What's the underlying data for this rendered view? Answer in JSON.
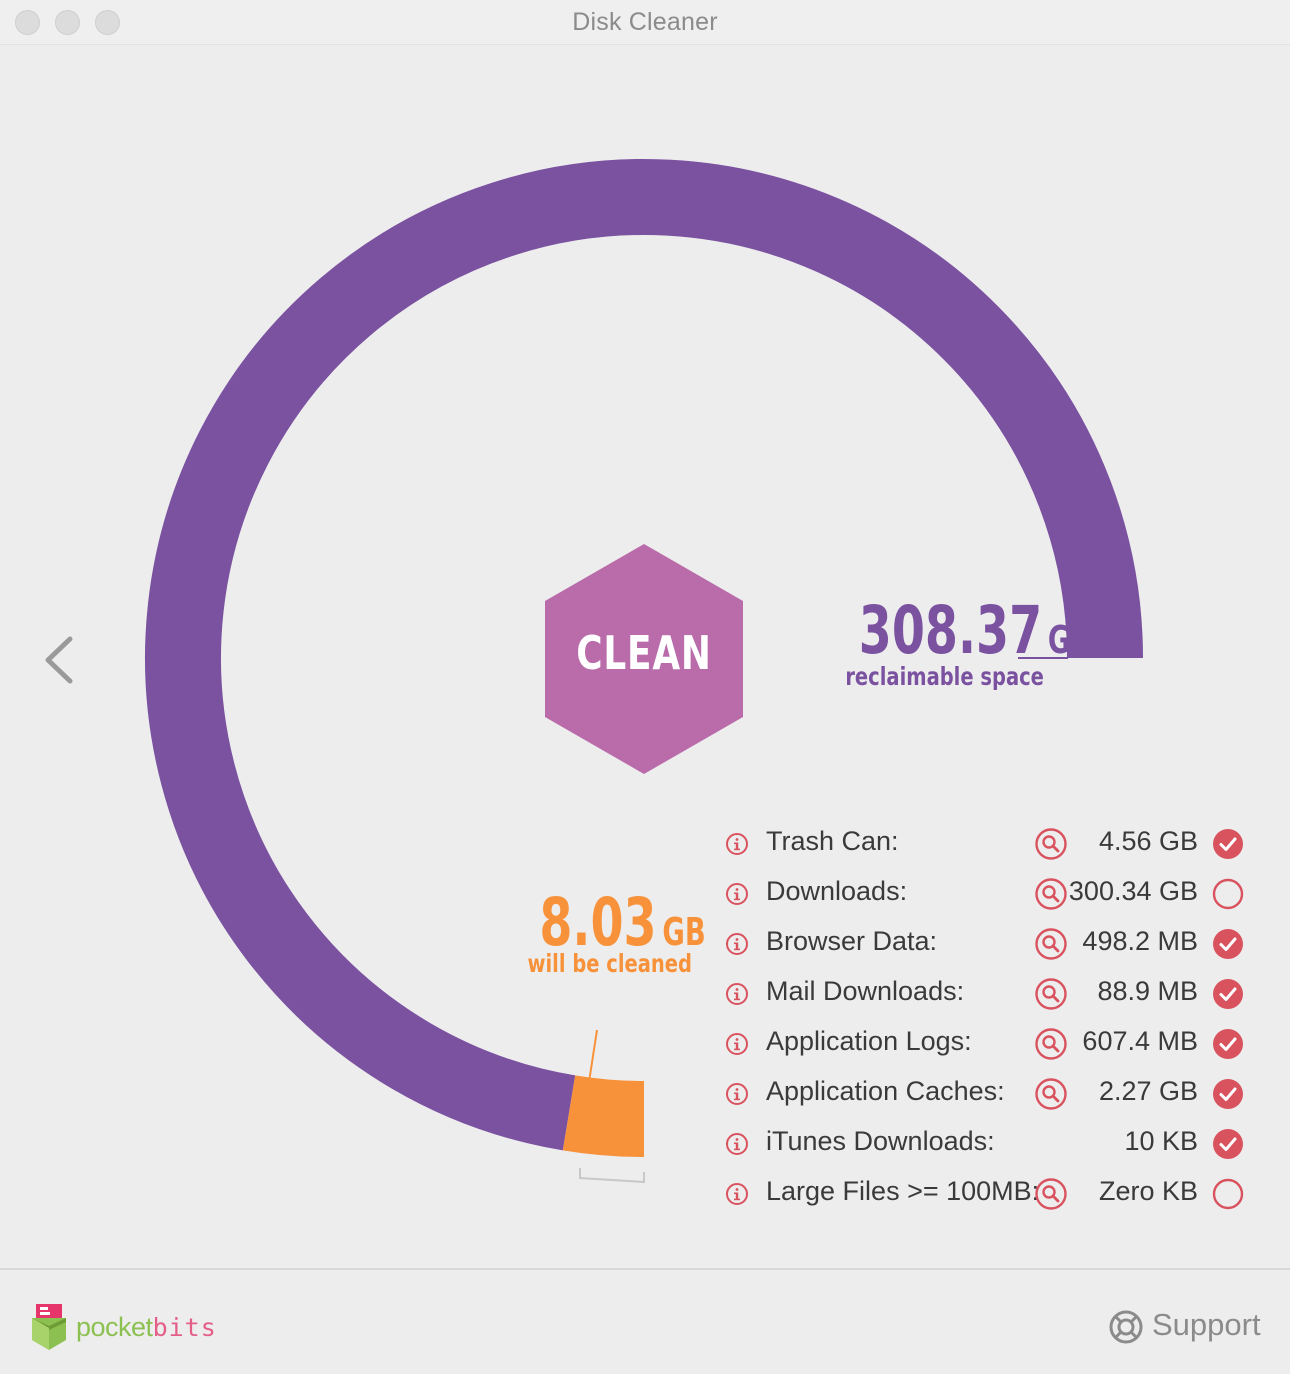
{
  "window": {
    "title": "Disk Cleaner"
  },
  "gauge": {
    "reclaimable_value": "308.37",
    "reclaimable_unit": "GB",
    "reclaimable_label": "reclaimable space",
    "cleaned_value": "8.03",
    "cleaned_unit": "GB",
    "cleaned_label": "will be cleaned",
    "fraction_to_clean": 0.026,
    "button_label": "CLEAN"
  },
  "items": [
    {
      "label": "Trash Can:",
      "size": "4.56 GB",
      "checked": true,
      "has_search": true
    },
    {
      "label": "Downloads:",
      "size": "300.34 GB",
      "checked": false,
      "has_search": true
    },
    {
      "label": "Browser Data:",
      "size": "498.2 MB",
      "checked": true,
      "has_search": true
    },
    {
      "label": "Mail Downloads:",
      "size": "88.9 MB",
      "checked": true,
      "has_search": true
    },
    {
      "label": "Application Logs:",
      "size": "607.4 MB",
      "checked": true,
      "has_search": true
    },
    {
      "label": "Application Caches:",
      "size": "2.27 GB",
      "checked": true,
      "has_search": true
    },
    {
      "label": "iTunes Downloads:",
      "size": "10 KB",
      "checked": true,
      "has_search": false
    },
    {
      "label": "Large Files >= 100MB:",
      "size": "Zero KB",
      "checked": false,
      "has_search": true
    }
  ],
  "footer": {
    "brand_part1": "pocket",
    "brand_part2": "bits",
    "support_label": "Support"
  },
  "colors": {
    "ring": "#7a52a0",
    "clean_segment": "#f7923a",
    "hexagon": "#b96baa",
    "accent_red": "#d9535f"
  },
  "icons": {
    "back": "chevron-left-icon",
    "info": "info-icon",
    "search": "search-icon",
    "checked": "check-circle-icon",
    "unchecked": "empty-circle-icon",
    "support": "lifebuoy-icon"
  }
}
